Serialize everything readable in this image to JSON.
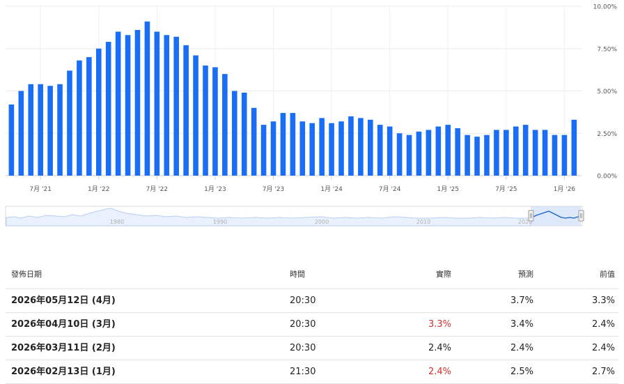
{
  "chart_data": {
    "type": "bar",
    "y_ticks": [
      "10.00%",
      "7.50%",
      "5.00%",
      "2.50%",
      "0.00%"
    ],
    "ylim": [
      0,
      10
    ],
    "x_tick_labels": [
      "7月 '21",
      "1月 '22",
      "7月 '22",
      "1月 '23",
      "7月 '23",
      "1月 '24",
      "7月 '24",
      "1月 '25",
      "7月 '25",
      "1月 '26"
    ],
    "x": [
      "2021-04",
      "2021-05",
      "2021-06",
      "2021-07",
      "2021-08",
      "2021-09",
      "2021-10",
      "2021-11",
      "2021-12",
      "2022-01",
      "2022-02",
      "2022-03",
      "2022-04",
      "2022-05",
      "2022-06",
      "2022-07",
      "2022-08",
      "2022-09",
      "2022-10",
      "2022-11",
      "2022-12",
      "2023-01",
      "2023-02",
      "2023-03",
      "2023-04",
      "2023-05",
      "2023-06",
      "2023-07",
      "2023-08",
      "2023-09",
      "2023-10",
      "2023-11",
      "2023-12",
      "2024-01",
      "2024-02",
      "2024-03",
      "2024-04",
      "2024-05",
      "2024-06",
      "2024-07",
      "2024-08",
      "2024-09",
      "2024-10",
      "2024-11",
      "2024-12",
      "2025-01",
      "2025-02",
      "2025-03",
      "2025-04",
      "2025-05",
      "2025-06",
      "2025-07",
      "2025-08",
      "2025-09",
      "2025-10",
      "2025-11",
      "2025-12",
      "2026-01",
      "2026-02",
      "2026-03"
    ],
    "values": [
      4.2,
      5.0,
      5.4,
      5.4,
      5.3,
      5.4,
      6.2,
      6.8,
      7.0,
      7.5,
      7.9,
      8.5,
      8.3,
      8.6,
      9.1,
      8.5,
      8.3,
      8.2,
      7.7,
      7.1,
      6.5,
      6.4,
      6.0,
      5.0,
      4.9,
      4.0,
      3.0,
      3.2,
      3.7,
      3.7,
      3.2,
      3.1,
      3.4,
      3.1,
      3.2,
      3.5,
      3.4,
      3.3,
      3.0,
      2.9,
      2.5,
      2.4,
      2.6,
      2.7,
      2.9,
      3.0,
      2.8,
      2.4,
      2.3,
      2.4,
      2.7,
      2.7,
      2.9,
      3.0,
      2.7,
      2.7,
      2.4,
      2.4,
      3.3
    ],
    "bar_color": "#1a6ef5",
    "grid": true
  },
  "navigator": {
    "year_labels": [
      "1980",
      "1990",
      "2000",
      "2010",
      "2020"
    ]
  },
  "table": {
    "headers": {
      "date": "發佈日期",
      "time": "時間",
      "actual": "實際",
      "forecast": "預測",
      "previous": "前值"
    },
    "rows": [
      {
        "date": "2026年05月12日 (4月)",
        "time": "20:30",
        "actual": "",
        "forecast": "3.7%",
        "previous": "3.3%",
        "actual_color": "#222222"
      },
      {
        "date": "2026年04月10日 (3月)",
        "time": "20:30",
        "actual": "3.3%",
        "forecast": "3.4%",
        "previous": "2.4%",
        "actual_color": "#d32f2f"
      },
      {
        "date": "2026年03月11日 (2月)",
        "time": "20:30",
        "actual": "2.4%",
        "forecast": "2.4%",
        "previous": "2.4%",
        "actual_color": "#222222"
      },
      {
        "date": "2026年02月13日 (1月)",
        "time": "21:30",
        "actual": "2.4%",
        "forecast": "2.5%",
        "previous": "2.7%",
        "actual_color": "#d32f2f"
      }
    ]
  }
}
